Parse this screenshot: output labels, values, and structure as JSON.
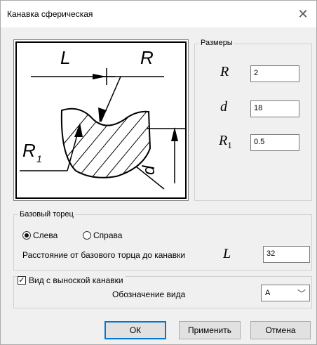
{
  "window": {
    "title": "Канавка сферическая",
    "close_icon": "close-icon"
  },
  "diagram": {
    "label_L": "L",
    "label_R": "R",
    "label_R1_base": "R",
    "label_R1_sub": "1",
    "label_d": "d"
  },
  "sizes": {
    "group_label": "Размеры",
    "params": [
      {
        "symbol": "R",
        "sub": "",
        "value": "2"
      },
      {
        "symbol": "d",
        "sub": "",
        "value": "18"
      },
      {
        "symbol": "R",
        "sub": "1",
        "value": "0.5"
      }
    ]
  },
  "base_face": {
    "group_label": "Базовый торец",
    "radio_left": "Слева",
    "radio_right": "Справа",
    "selected": "left",
    "distance_label": "Расстояние от базового торца до канавки",
    "distance_symbol": "L",
    "distance_value": "32"
  },
  "view": {
    "checkbox_label": "Вид с выноской канавки",
    "checked": true,
    "designation_label": "Обозначение вида",
    "designation_value": "A"
  },
  "buttons": {
    "ok": "ОК",
    "apply": "Применить",
    "cancel": "Отмена"
  }
}
